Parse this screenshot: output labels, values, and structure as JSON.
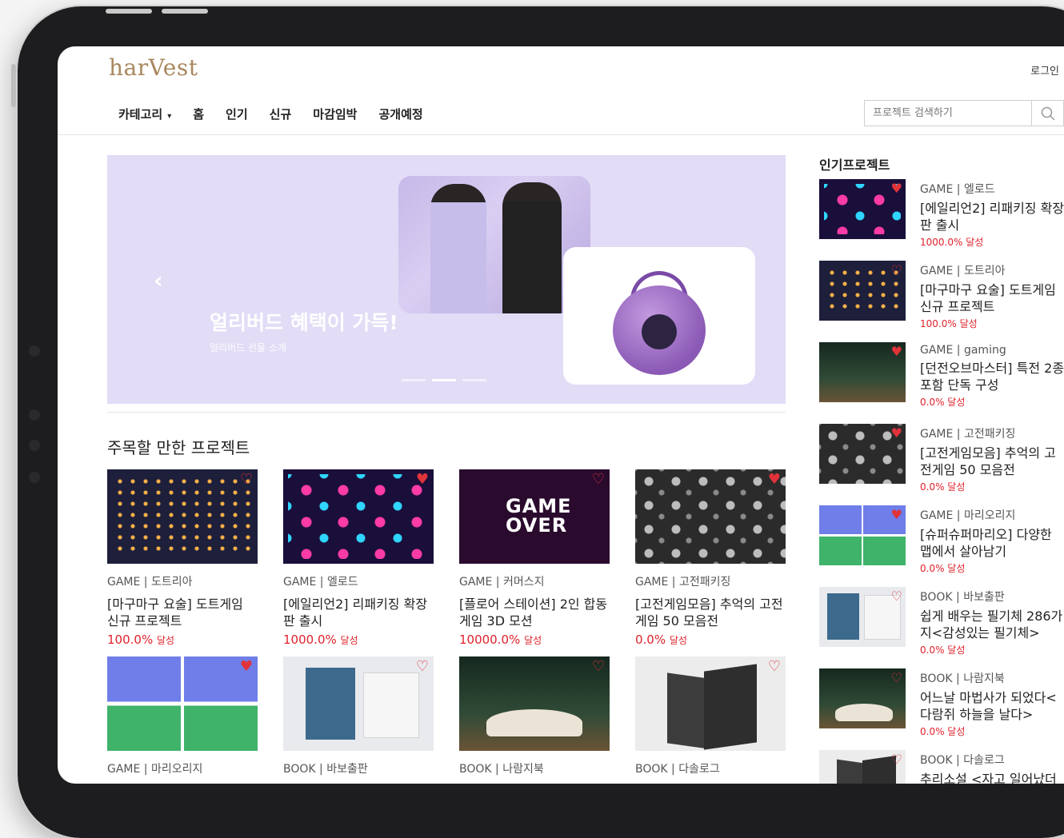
{
  "header": {
    "logo": "harVest",
    "login": "로그인",
    "search_placeholder": "프로젝트 검색하기",
    "nav": [
      {
        "label": "카테고리",
        "caret": "▾"
      },
      {
        "label": "홈"
      },
      {
        "label": "인기"
      },
      {
        "label": "신규"
      },
      {
        "label": "마감임박"
      },
      {
        "label": "공개예정"
      }
    ]
  },
  "banner": {
    "title": "얼리버드 혜택이 가득!",
    "subtitle": "얼리버드 선물 소개",
    "prev_arrow": "‹",
    "active_dot": 1
  },
  "featured": {
    "title": "주목할 만한 프로젝트",
    "cards": [
      {
        "category": "GAME | 도트리아",
        "title": "[마구마구 요술] 도트게임 신규 프로젝트",
        "percent": "100.0%",
        "suffix": "달성",
        "heart": "outline",
        "thumb": "icons"
      },
      {
        "category": "GAME | 엘로드",
        "title": "[에일리언2] 리패키징 확장판 출시",
        "percent": "1000.0%",
        "suffix": "달성",
        "heart": "filled",
        "thumb": "neon"
      },
      {
        "category": "GAME | 커머스지",
        "title": "[플로어 스테이션] 2인 합동 게임 3D 모션",
        "percent": "10000.0%",
        "suffix": "달성",
        "heart": "outline",
        "thumb": "glitch",
        "thumb_text": "GAME OVER"
      },
      {
        "category": "GAME | 고전패키징",
        "title": "[고전게임모음] 추억의 고전게임 50 모음전",
        "percent": "0.0%",
        "suffix": "달성",
        "heart": "filled",
        "thumb": "pads"
      },
      {
        "category": "GAME | 마리오리지",
        "title": "",
        "percent": "",
        "suffix": "",
        "heart": "filled",
        "thumb": "pixel"
      },
      {
        "category": "BOOK | 바보출판",
        "title": "",
        "percent": "",
        "suffix": "",
        "heart": "outline",
        "thumb": "book1"
      },
      {
        "category": "BOOK | 나람지북",
        "title": "",
        "percent": "",
        "suffix": "",
        "heart": "outline",
        "thumb": "book2"
      },
      {
        "category": "BOOK | 다솔로그",
        "title": "",
        "percent": "",
        "suffix": "",
        "heart": "outline",
        "thumb": "book3"
      }
    ]
  },
  "popular": {
    "title": "인기프로젝트",
    "items": [
      {
        "category": "GAME | 엘로드",
        "title": "[에일리언2] 리패키징 확장판 출시",
        "percent": "1000.0% 달성",
        "heart": "filled",
        "thumb": "neon"
      },
      {
        "category": "GAME | 도트리아",
        "title": "[마구마구 요술] 도트게임 신규 프로젝트",
        "percent": "100.0% 달성",
        "heart": "outline",
        "thumb": "icons"
      },
      {
        "category": "GAME | gaming",
        "title": "[던전오브마스터] 특전 2종 포함 단독 구성",
        "percent": "0.0% 달성",
        "heart": "filled",
        "thumb": "book2"
      },
      {
        "category": "GAME | 고전패키징",
        "title": "[고전게임모음] 추억의 고전게임 50 모음전",
        "percent": "0.0% 달성",
        "heart": "filled",
        "thumb": "pads"
      },
      {
        "category": "GAME | 마리오리지",
        "title": "[슈퍼슈퍼마리오] 다양한 맵에서 살아남기",
        "percent": "0.0% 달성",
        "heart": "filled",
        "thumb": "pixel"
      },
      {
        "category": "BOOK | 바보출판",
        "title": "쉽게 배우는 필기체 286가지<감성있는 필기체>",
        "percent": "0.0% 달성",
        "heart": "outline",
        "thumb": "book1"
      },
      {
        "category": "BOOK | 나람지북",
        "title": "어느날 마법사가 되었다<다람쥐 하늘을 날다>",
        "percent": "0.0% 달성",
        "heart": "outline",
        "thumb": "book2"
      },
      {
        "category": "BOOK | 다솔로그",
        "title": "추리소설 <자고 일어났더",
        "percent": "",
        "heart": "outline",
        "thumb": "book3"
      }
    ]
  },
  "colors": {
    "brand": "#a9875e",
    "accent_red": "#e0222b",
    "banner_bg": "#e2dcf6"
  }
}
